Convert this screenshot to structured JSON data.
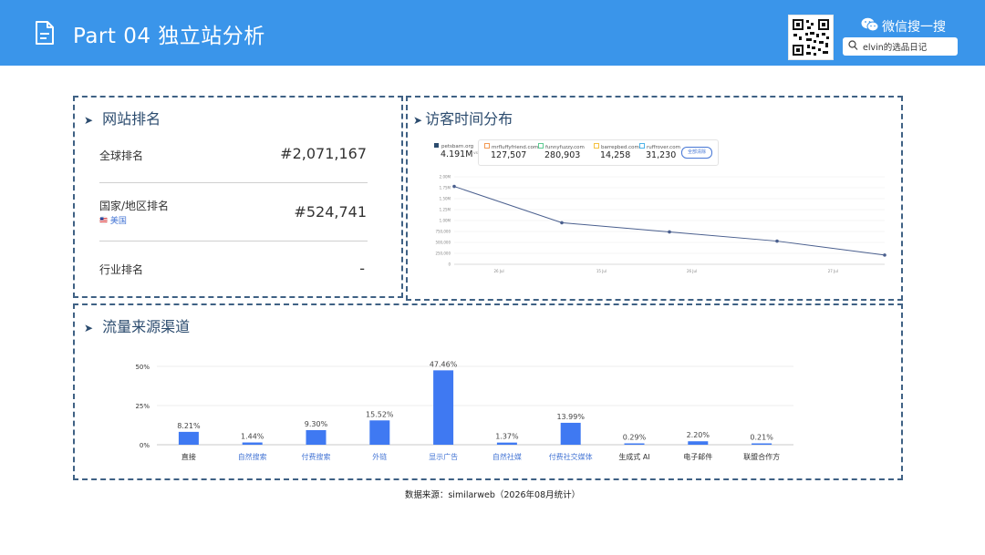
{
  "header": {
    "title": "Part 04 独立站分析",
    "wechat_label": "微信搜一搜",
    "search_value": "elvin的选品日记",
    "qr_label": "qr-code"
  },
  "ranking": {
    "title": "网站排名",
    "global_label": "全球排名",
    "global_value": "#2,071,167",
    "country_label": "国家/地区排名",
    "country_name": "美国",
    "country_value": "#524,741",
    "industry_label": "行业排名",
    "industry_value": "-"
  },
  "visits": {
    "title": "访客时间分布",
    "sites": [
      {
        "name": "petsbarn.org",
        "value": "4.191M",
        "color": "#2b4b6e"
      },
      {
        "name": "mrfluffyfriend.com",
        "value": "127,507",
        "color": "#f39a53"
      },
      {
        "name": "funnyfuzzy.com",
        "value": "280,903",
        "color": "#5ecb92"
      },
      {
        "name": "barrepbed.com",
        "value": "14,258",
        "color": "#f5c242"
      },
      {
        "name": "ruffrover.com",
        "value": "31,230",
        "color": "#4db3e8"
      }
    ],
    "vs_label": "vs",
    "compare_button": "全部清除",
    "y_ticks": [
      "2.00M",
      "1.75M",
      "1.50M",
      "1.25M",
      "1.00M",
      "750,000",
      "500,000",
      "250,000",
      "0"
    ],
    "x_ticks": [
      "26 Jul",
      "15 Jul",
      "26 Jul",
      "27 Jul"
    ]
  },
  "chart_data": {
    "type": "bar",
    "title": "流量来源渠道",
    "categories": [
      "直接",
      "自然搜索",
      "付费搜索",
      "外链",
      "显示广告",
      "自然社媒",
      "付费社交媒体",
      "生成式 AI",
      "电子邮件",
      "联盟合作方"
    ],
    "values": [
      8.21,
      1.44,
      9.3,
      15.52,
      47.46,
      1.37,
      13.99,
      0.29,
      2.2,
      0.21
    ],
    "labels": [
      "8.21%",
      "1.44%",
      "9.30%",
      "15.52%",
      "47.46%",
      "1.37%",
      "13.99%",
      "0.29%",
      "2.20%",
      "0.21%"
    ],
    "link_categories": [
      false,
      true,
      true,
      true,
      true,
      true,
      true,
      false,
      false,
      false
    ],
    "y_ticks": [
      "50%",
      "25%",
      "0%"
    ],
    "ylim": [
      0,
      50
    ],
    "bar_color": "#3f79f2"
  },
  "line_chart_data": {
    "type": "line",
    "values": [
      1.78,
      0.95,
      0.74,
      0.53,
      0.21
    ],
    "ylim": [
      0,
      2.0
    ],
    "color": "#4a5f8e"
  },
  "footer": {
    "source": "数据来源：similarweb（2026年08月统计）"
  }
}
